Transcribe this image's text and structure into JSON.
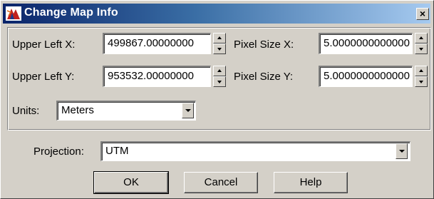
{
  "window": {
    "title": "Change Map Info",
    "close_glyph": "×",
    "icon": "map-app-icon"
  },
  "fields": {
    "upper_left_x": {
      "label": "Upper Left X:",
      "value": "499867.00000000"
    },
    "upper_left_y": {
      "label": "Upper Left Y:",
      "value": "953532.00000000"
    },
    "pixel_size_x": {
      "label": "Pixel Size X:",
      "value": "5.0000000000000"
    },
    "pixel_size_y": {
      "label": "Pixel Size Y:",
      "value": "5.0000000000000"
    }
  },
  "units": {
    "label": "Units:",
    "value": "Meters"
  },
  "projection": {
    "label": "Projection:",
    "value": "UTM"
  },
  "buttons": {
    "ok": "OK",
    "cancel": "Cancel",
    "help": "Help"
  },
  "colors": {
    "title_start": "#0a246a",
    "title_end": "#a6caf0",
    "face": "#d4d0c8"
  }
}
